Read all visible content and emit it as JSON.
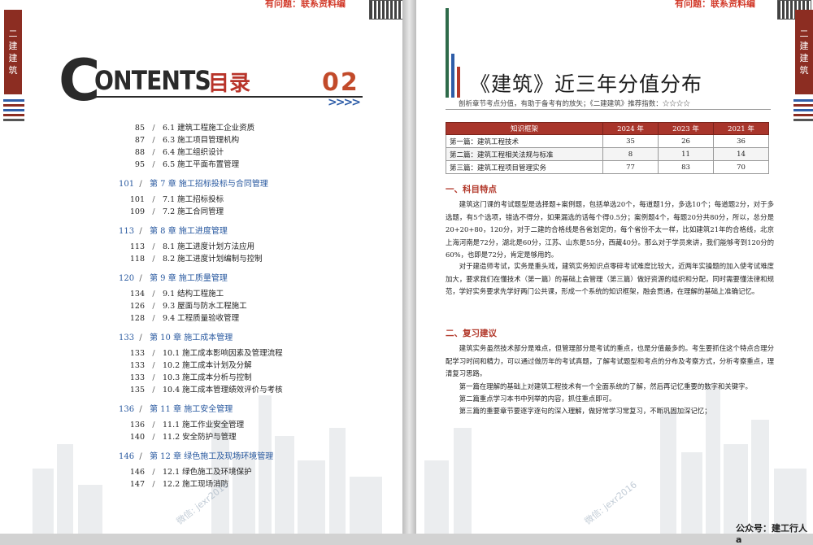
{
  "left": {
    "side_tab": [
      "二",
      "建",
      "建",
      "筑"
    ],
    "top_note": "有问题：联系资料编",
    "header": {
      "logo_word": "ONTENTS",
      "logo_c": "C",
      "title_cn": "目录",
      "chapter_no": "02",
      "arrows": ">>>>"
    },
    "toc": [
      {
        "type": "sub",
        "page": "85",
        "text": "6.1 建筑工程施工企业资质"
      },
      {
        "type": "sub",
        "page": "87",
        "text": "6.3 施工项目管理机构"
      },
      {
        "type": "sub",
        "page": "88",
        "text": "6.4 施工组织设计"
      },
      {
        "type": "sub",
        "page": "95",
        "text": "6.5 施工平面布置管理"
      },
      {
        "type": "chap",
        "page": "101",
        "text": "第 7 章   施工招标投标与合同管理"
      },
      {
        "type": "sub",
        "page": "101",
        "text": "7.1 施工招标投标"
      },
      {
        "type": "sub",
        "page": "109",
        "text": "7.2 施工合同管理"
      },
      {
        "type": "chap",
        "page": "113",
        "text": "第 8 章   施工进度管理"
      },
      {
        "type": "sub",
        "page": "113",
        "text": "8.1 施工进度计划方法应用"
      },
      {
        "type": "sub",
        "page": "118",
        "text": "8.2 施工进度计划编制与控制"
      },
      {
        "type": "chap",
        "page": "120",
        "text": "第 9 章   施工质量管理"
      },
      {
        "type": "sub",
        "page": "134",
        "text": "9.1 结构工程施工"
      },
      {
        "type": "sub",
        "page": "126",
        "text": "9.3 屋面与防水工程施工"
      },
      {
        "type": "sub",
        "page": "128",
        "text": "9.4 工程质量验收管理"
      },
      {
        "type": "chap",
        "page": "133",
        "text": "第 10 章   施工成本管理"
      },
      {
        "type": "sub",
        "page": "133",
        "text": "10.1 施工成本影响因素及管理流程"
      },
      {
        "type": "sub",
        "page": "133",
        "text": "10.2 施工成本计划及分解"
      },
      {
        "type": "sub",
        "page": "133",
        "text": "10.3 施工成本分析与控制"
      },
      {
        "type": "sub",
        "page": "135",
        "text": "10.4 施工成本管理绩效评价与考核"
      },
      {
        "type": "chap",
        "page": "136",
        "text": "第 11 章   施工安全管理"
      },
      {
        "type": "sub",
        "page": "136",
        "text": "11.1 施工作业安全管理"
      },
      {
        "type": "sub",
        "page": "140",
        "text": "11.2 安全防护与管理"
      },
      {
        "type": "chap",
        "page": "146",
        "text": "第 12 章   绿色施工及现场环境管理"
      },
      {
        "type": "sub",
        "page": "146",
        "text": "12.1 绿色施工及环境保护"
      },
      {
        "type": "sub",
        "page": "147",
        "text": "12.2 施工现场消防"
      }
    ],
    "watermark": "微信: jexr2016"
  },
  "right": {
    "side_tab": [
      "二",
      "建",
      "建",
      "筑"
    ],
    "top_note": "有问题：联系资料编",
    "title": "《建筑》近三年分值分布",
    "subtitle": "剖析章节考点分值，有助于备考有的放矢；《二建建筑》推荐指数：☆☆☆☆",
    "table": {
      "headers": [
        "知识框架",
        "2024 年",
        "2023 年",
        "2021 年"
      ],
      "rows": [
        [
          "第一篇：建筑工程技术",
          "35",
          "26",
          "36"
        ],
        [
          "第二篇：建筑工程相关法规与标准",
          "8",
          "11",
          "14"
        ],
        [
          "第三篇：建筑工程项目管理实务",
          "77",
          "83",
          "70"
        ]
      ]
    },
    "section1": {
      "heading": "一、科目特点",
      "p1": "建筑这门课的考试题型是选择题+案例题，包括单选20个，每道题1分，多选10个；每道题2分，对于多选题，有5个选项，错选不得分，如果漏选的话每个得0.5分；案例题4个，每题20分共80分，所以，总分是20+20+80，120分，对于二建的合格线是各省划定的，每个省份不太一样，比如建筑21年的合格线，北京上海河南是72分，湖北是60分，江苏、山东是55分，西藏40分。那么对于学员来讲，我们能够考到120分的60%，也即是72分，肯定是够用的。",
      "p2": "对于建造师考试，实务是重头戏，建筑实务知识点零碎考试难度比较大，近两年实操题的加入使考试难度加大，要求我们在懂技术（第一篇）的基础上会管理（第三篇）做好资源的组织和分配，同时需要懂法律和规范，学好实务要求先学好两门公共课，形成一个系统的知识框架，融会贯通，在理解的基础上准确记忆。"
    },
    "section2": {
      "heading": "二、复习建议",
      "p1": "建筑实务虽然技术部分是难点，但管理部分是考试的重点，也是分值最多的。考生要抓住这个特点合理分配学习时间和精力，可以通过做历年的考试真题，了解考试题型和考点的分布及考察方式，分析考察重点，理清复习思路。",
      "p2": "第一篇在理解的基础上对建筑工程技术有一个全面系统的了解，然后再记忆重要的数字和关键字。",
      "p3": "第二篇重点学习本书中列举的内容，抓住重点即可。",
      "p4": "第三篇的重要章节要逐字逐句的深入理解，做好常学习常复习，不断巩固加深记忆；"
    },
    "bottom_note": "公众号：建工行人a",
    "watermark": "微信: jexr2016"
  }
}
